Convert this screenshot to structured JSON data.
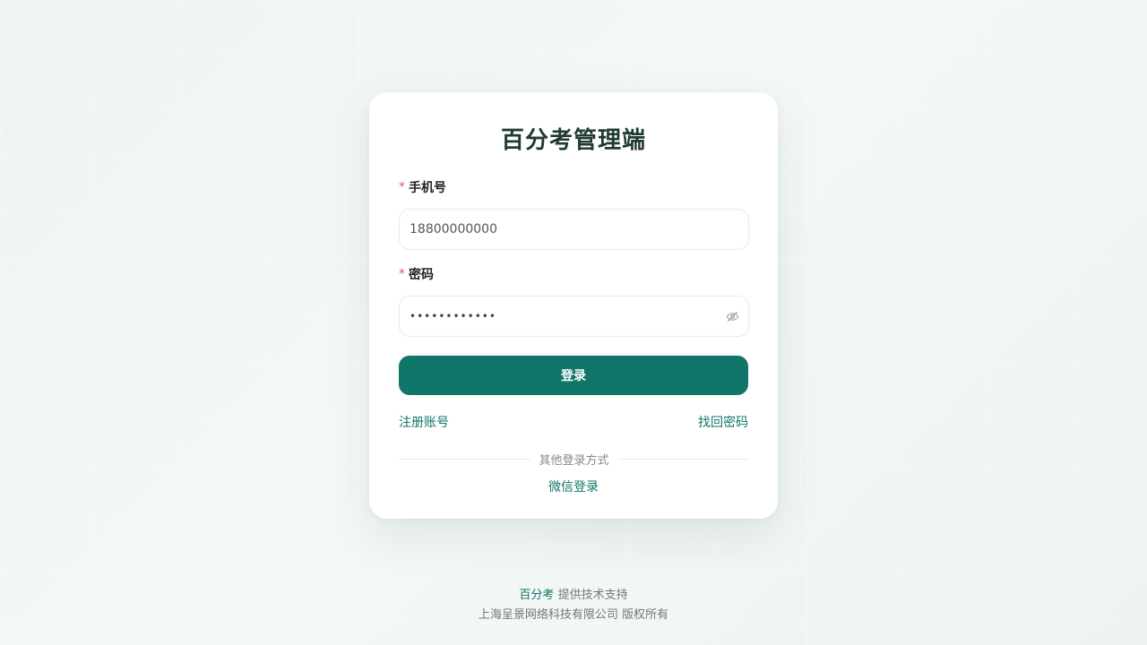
{
  "login": {
    "title": "百分考管理端",
    "phone_label": "手机号",
    "phone_value": "18800000000",
    "password_label": "密码",
    "password_masked": "••••••••••••",
    "required_mark": "*",
    "submit_label": "登录",
    "register_link": "注册账号",
    "forgot_link": "找回密码",
    "other_methods": "其他登录方式",
    "wechat_link": "微信登录"
  },
  "footer": {
    "brand": "百分考",
    "support_text": "提供技术支持",
    "copyright": "上海呈景网络科技有限公司 版权所有"
  },
  "colors": {
    "accent": "#11766a",
    "required": "#e0566a",
    "title": "#1f3b30"
  },
  "icons": {
    "password_toggle": "eye-off-icon"
  }
}
